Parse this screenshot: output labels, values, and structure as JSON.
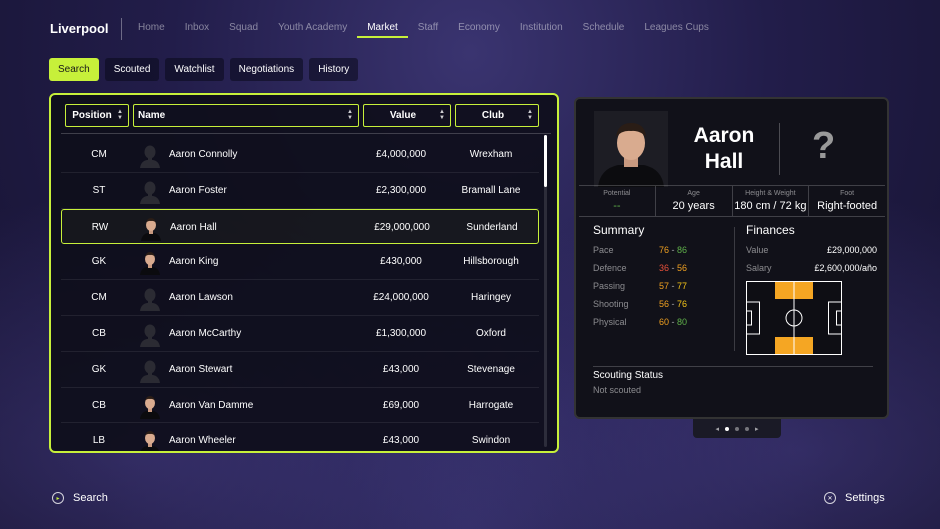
{
  "app": {
    "club_name": "Liverpool"
  },
  "nav": {
    "items": [
      {
        "label": "Home",
        "active": false
      },
      {
        "label": "Inbox",
        "active": false
      },
      {
        "label": "Squad",
        "active": false
      },
      {
        "label": "Youth Academy",
        "active": false
      },
      {
        "label": "Market",
        "active": true
      },
      {
        "label": "Staff",
        "active": false
      },
      {
        "label": "Economy",
        "active": false
      },
      {
        "label": "Institution",
        "active": false
      },
      {
        "label": "Schedule",
        "active": false
      },
      {
        "label": "Leagues  Cups",
        "active": false
      }
    ]
  },
  "subtabs": [
    {
      "label": "Search",
      "active": true
    },
    {
      "label": "Scouted",
      "active": false
    },
    {
      "label": "Watchlist",
      "active": false
    },
    {
      "label": "Negotiations",
      "active": false
    },
    {
      "label": "History",
      "active": false
    }
  ],
  "table": {
    "headers": {
      "position": "Position",
      "name": "Name",
      "value": "Value",
      "club": "Club"
    },
    "rows": [
      {
        "position": "CM",
        "name": "Aaron Connolly",
        "value": "£4,000,000",
        "club": "Wrexham",
        "has_photo": false,
        "selected": false
      },
      {
        "position": "ST",
        "name": "Aaron Foster",
        "value": "£2,300,000",
        "club": "Bramall Lane",
        "has_photo": false,
        "selected": false
      },
      {
        "position": "RW",
        "name": "Aaron Hall",
        "value": "£29,000,000",
        "club": "Sunderland",
        "has_photo": true,
        "selected": true
      },
      {
        "position": "GK",
        "name": "Aaron King",
        "value": "£430,000",
        "club": "Hillsborough",
        "has_photo": true,
        "selected": false
      },
      {
        "position": "CM",
        "name": "Aaron Lawson",
        "value": "£24,000,000",
        "club": "Haringey",
        "has_photo": false,
        "selected": false
      },
      {
        "position": "CB",
        "name": "Aaron McCarthy",
        "value": "£1,300,000",
        "club": "Oxford",
        "has_photo": false,
        "selected": false
      },
      {
        "position": "GK",
        "name": "Aaron Stewart",
        "value": "£43,000",
        "club": "Stevenage",
        "has_photo": false,
        "selected": false
      },
      {
        "position": "CB",
        "name": "Aaron Van Damme",
        "value": "£69,000",
        "club": "Harrogate",
        "has_photo": true,
        "selected": false
      },
      {
        "position": "LB",
        "name": "Aaron Wheeler",
        "value": "£43,000",
        "club": "Swindon",
        "has_photo": true,
        "selected": false
      }
    ]
  },
  "player": {
    "first_name": "Aaron",
    "last_name": "Hall",
    "unknown_mark": "?",
    "stats": {
      "potential_label": "Potential",
      "potential_value": "--",
      "age_label": "Age",
      "age_value": "20 years",
      "hw_label": "Height & Weight",
      "hw_value": "180 cm / 72 kg",
      "foot_label": "Foot",
      "foot_value": "Right-footed"
    },
    "summary": {
      "title": "Summary",
      "attributes": [
        {
          "label": "Pace",
          "low": "76",
          "high": "86",
          "low_color": "#f0a020",
          "high_color": "#5fb04a"
        },
        {
          "label": "Defence",
          "low": "36",
          "high": "56",
          "low_color": "#e8503a",
          "high_color": "#f0a020"
        },
        {
          "label": "Passing",
          "low": "57",
          "high": "77",
          "low_color": "#f0a020",
          "high_color": "#f5c518"
        },
        {
          "label": "Shooting",
          "low": "56",
          "high": "76",
          "low_color": "#f0a020",
          "high_color": "#f5c518"
        },
        {
          "label": "Physical",
          "low": "60",
          "high": "80",
          "low_color": "#f0a020",
          "high_color": "#5fb04a"
        }
      ]
    },
    "finances": {
      "title": "Finances",
      "value_label": "Value",
      "value": "£29,000,000",
      "salary_label": "Salary",
      "salary": "£2,600,000/año"
    },
    "scouting": {
      "title": "Scouting Status",
      "status": "Not scouted"
    }
  },
  "pager": {
    "prev": "◂",
    "next": "▸"
  },
  "footer": {
    "left_label": "Search",
    "right_label": "Settings",
    "left_glyph": "▸",
    "right_glyph": "✕"
  },
  "colors": {
    "accent": "#c7f03a",
    "pitch_highlight": "#f5a623"
  }
}
